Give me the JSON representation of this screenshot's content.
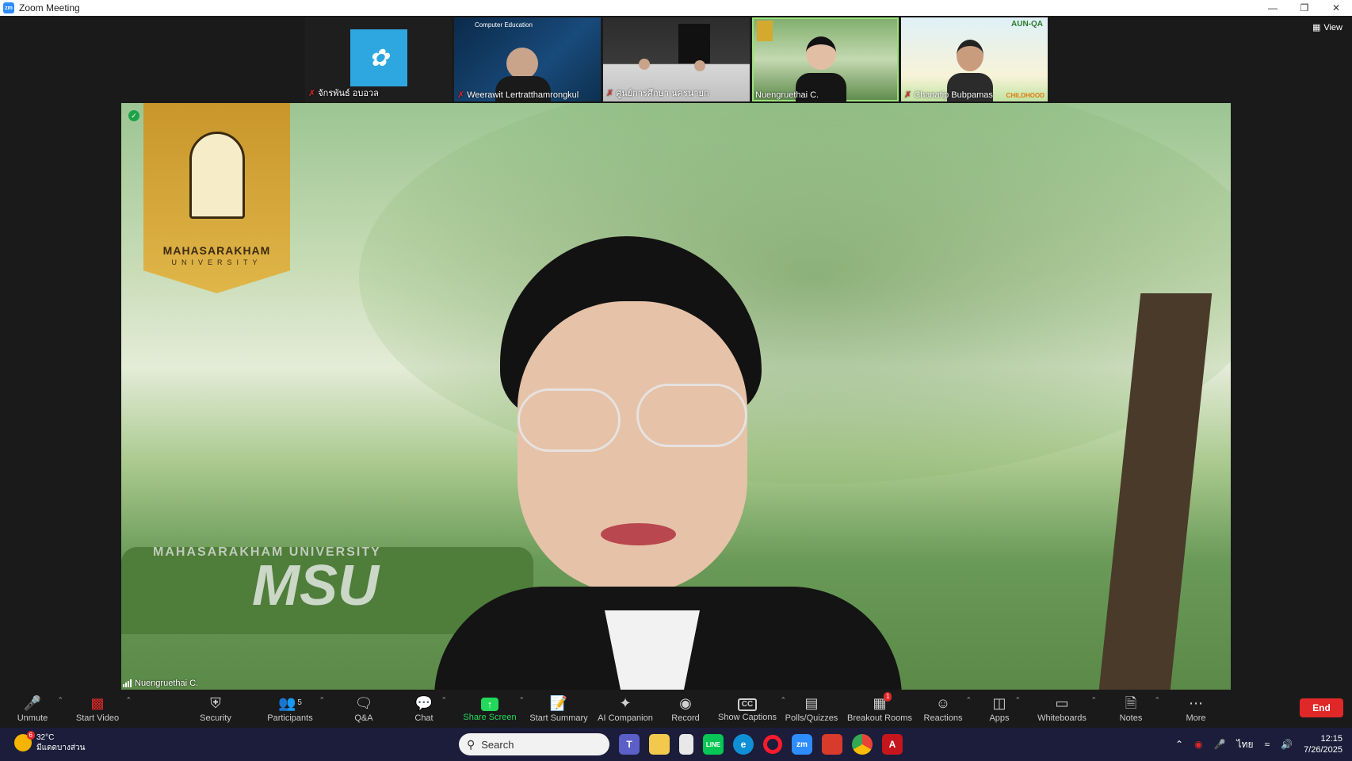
{
  "window": {
    "title": "Zoom Meeting",
    "app_icon": "zm",
    "controls": [
      "minimize-icon",
      "restore-icon",
      "close-icon"
    ]
  },
  "view_button": {
    "label": "View"
  },
  "thumbnails": [
    {
      "name": "จักรพันธ์ อบอวล",
      "muted": true
    },
    {
      "name": "Weerawit Lertratthamrongkul",
      "muted": true,
      "banner": "Computer Education"
    },
    {
      "name": "ศูนย์การศึกษา นครนายก",
      "muted": true
    },
    {
      "name": "Nuengruethai C.",
      "muted": false,
      "active": true
    },
    {
      "name": "Chanatip Bubpamas",
      "muted": true,
      "banner": "AUN-QA",
      "corner_text": "CHILDHOOD"
    }
  ],
  "main_video": {
    "speaker": "Nuengruethai C.",
    "logo_line1": "MAHASARAKHAM",
    "logo_line2": "UNIVERSITY",
    "sign_text": "MSU",
    "sign_subtext": "MAHASARAKHAM UNIVERSITY"
  },
  "toolbar": {
    "items": [
      {
        "key": "unmute",
        "label": "Unmute",
        "icon": "mic-muted-icon",
        "caret": true
      },
      {
        "key": "start_video",
        "label": "Start Video",
        "icon": "video-off-icon",
        "caret": true
      },
      {
        "key": "security",
        "label": "Security",
        "icon": "shield-icon"
      },
      {
        "key": "participants",
        "label": "Participants",
        "icon": "participants-icon",
        "count": "5",
        "caret": true
      },
      {
        "key": "qa",
        "label": "Q&A",
        "icon": "qa-icon"
      },
      {
        "key": "chat",
        "label": "Chat",
        "icon": "chat-icon",
        "caret": true
      },
      {
        "key": "share_screen",
        "label": "Share Screen",
        "icon": "share-screen-icon",
        "caret": true
      },
      {
        "key": "start_summary",
        "label": "Start Summary",
        "icon": "summary-icon"
      },
      {
        "key": "ai_companion",
        "label": "AI Companion",
        "icon": "ai-sparkle-icon"
      },
      {
        "key": "record",
        "label": "Record",
        "icon": "record-icon"
      },
      {
        "key": "captions",
        "label": "Show Captions",
        "icon": "cc-icon",
        "caret": true
      },
      {
        "key": "polls",
        "label": "Polls/Quizzes",
        "icon": "polls-icon"
      },
      {
        "key": "breakout",
        "label": "Breakout Rooms",
        "icon": "breakout-icon",
        "badge": "1"
      },
      {
        "key": "reactions",
        "label": "Reactions",
        "icon": "reactions-icon",
        "caret": true
      },
      {
        "key": "apps",
        "label": "Apps",
        "icon": "apps-icon",
        "caret": true
      },
      {
        "key": "whiteboards",
        "label": "Whiteboards",
        "icon": "whiteboard-icon",
        "caret": true
      },
      {
        "key": "notes",
        "label": "Notes",
        "icon": "notes-icon",
        "caret": true
      },
      {
        "key": "more",
        "label": "More",
        "icon": "more-icon"
      }
    ],
    "end_label": "End"
  },
  "taskbar": {
    "weather_badge": "6",
    "weather_temp": "32°C",
    "weather_desc": "มีแดดบางส่วน",
    "search_placeholder": "Search",
    "apps": [
      "windows-start-icon",
      "search-box",
      "teams-icon",
      "file-explorer-icon",
      "notepad-icon",
      "line-icon",
      "edge-icon",
      "opera-icon",
      "zoom-icon",
      "snipping-tool-icon",
      "chrome-icon",
      "acrobat-icon"
    ],
    "tray_lang": "ไทย",
    "time": "12:15",
    "date": "7/26/2025"
  },
  "colors": {
    "end_red": "#e02828",
    "share_green": "#23d959",
    "active_border": "#9be07a",
    "taskbar_bg": "#1b1d3a",
    "zoom_blue": "#2d8cff"
  }
}
